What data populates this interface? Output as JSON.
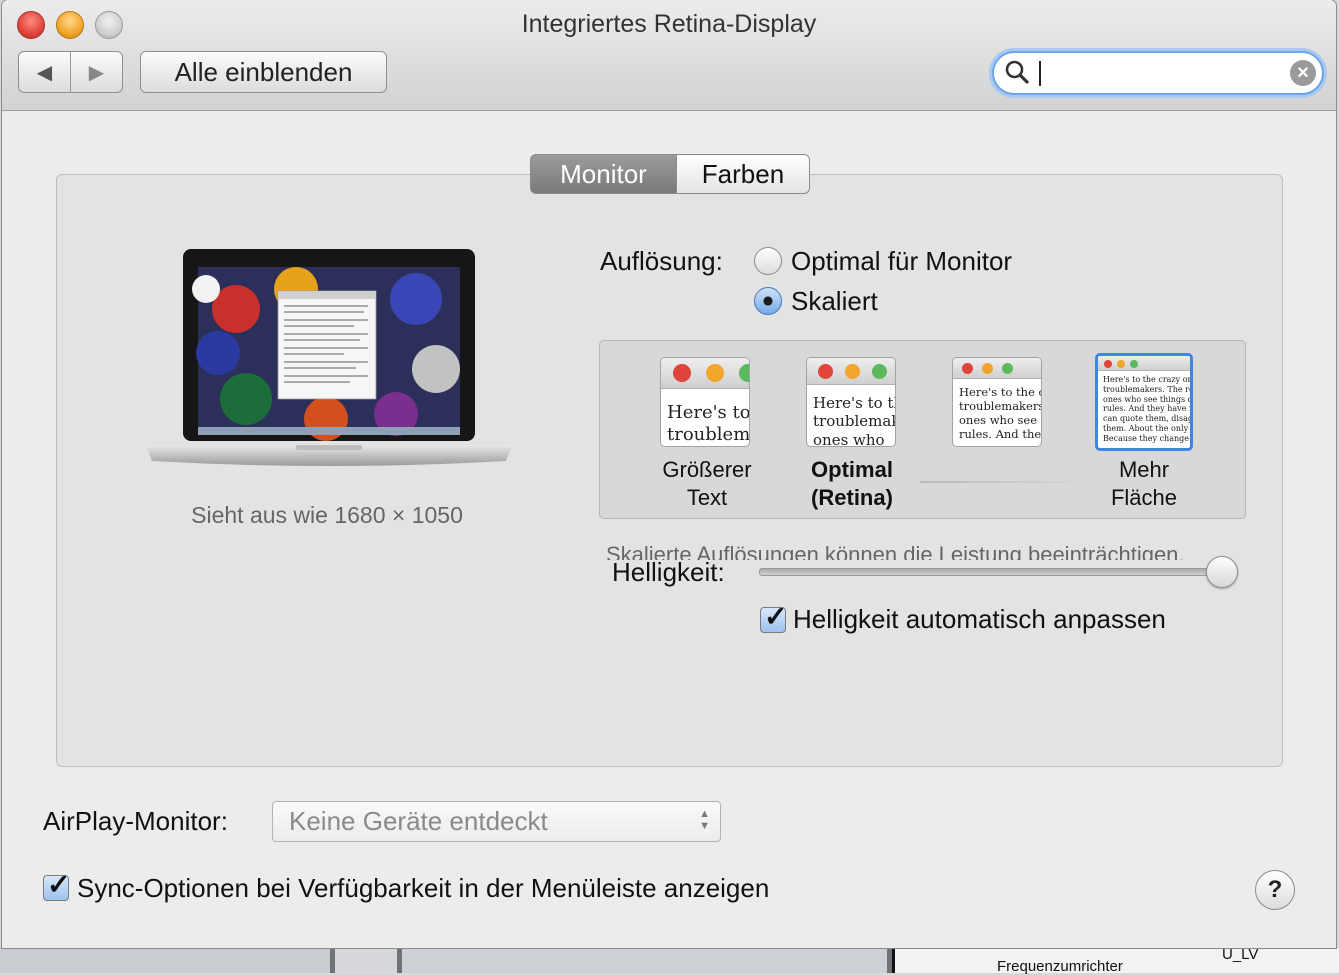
{
  "window": {
    "title": "Integriertes Retina-Display"
  },
  "toolbar": {
    "back_glyph": "◀",
    "forward_glyph": "▶",
    "show_all_label": "Alle einblenden",
    "search_value": "",
    "search_icon": "magnifier-icon",
    "clear_icon": "clear-icon"
  },
  "tabs": [
    {
      "label": "Monitor",
      "selected": true
    },
    {
      "label": "Farben",
      "selected": false
    }
  ],
  "display": {
    "looks_like": "Sieht aus wie 1680 × 1050",
    "resolution_label": "Auflösung:",
    "options": [
      {
        "label": "Optimal für Monitor",
        "selected": false
      },
      {
        "label": "Skaliert",
        "selected": true
      }
    ],
    "scale_options": [
      {
        "line1": "Größerer",
        "line2": "Text",
        "preview": "Here's to\ntroublem",
        "selected": false,
        "bold": false
      },
      {
        "line1": "Optimal",
        "line2": "(Retina)",
        "preview": "Here's to th\ntroublemak\nones who",
        "selected": false,
        "bold": true
      },
      {
        "line1": "",
        "line2": "",
        "preview": "Here's to the cr\ntroublemakers.\nones who see t\nrules. And they",
        "selected": false,
        "bold": false
      },
      {
        "line1": "Mehr",
        "line2": "Fläche",
        "preview": "Here's to the crazy one\ntroublemakers. The rou\nones who see things di\nrules. And they have no\ncan quote them, disagre\nthem. About the only th\nBecause they change th",
        "selected": true,
        "bold": false
      }
    ],
    "performance_note": "Skalierte Auflösungen können die Leistung beeinträchtigen.",
    "brightness_label": "Helligkeit:",
    "brightness_level": 1.0,
    "auto_brightness_label": "Helligkeit automatisch anpassen",
    "auto_brightness_checked": true
  },
  "airplay": {
    "label": "AirPlay-Monitor:",
    "value": "Keine Geräte entdeckt"
  },
  "sync": {
    "label": "Sync-Optionen bei Verfügbarkeit in der Menüleiste anzeigen",
    "checked": true
  },
  "help_label": "?",
  "background": {
    "text1": "Frequenzumrichter",
    "text2": "U_LV"
  },
  "colors": {
    "accent": "#3f86e0",
    "close": "#e0443a",
    "minimize": "#f2a52c",
    "zoom": "#cfcfcf"
  }
}
